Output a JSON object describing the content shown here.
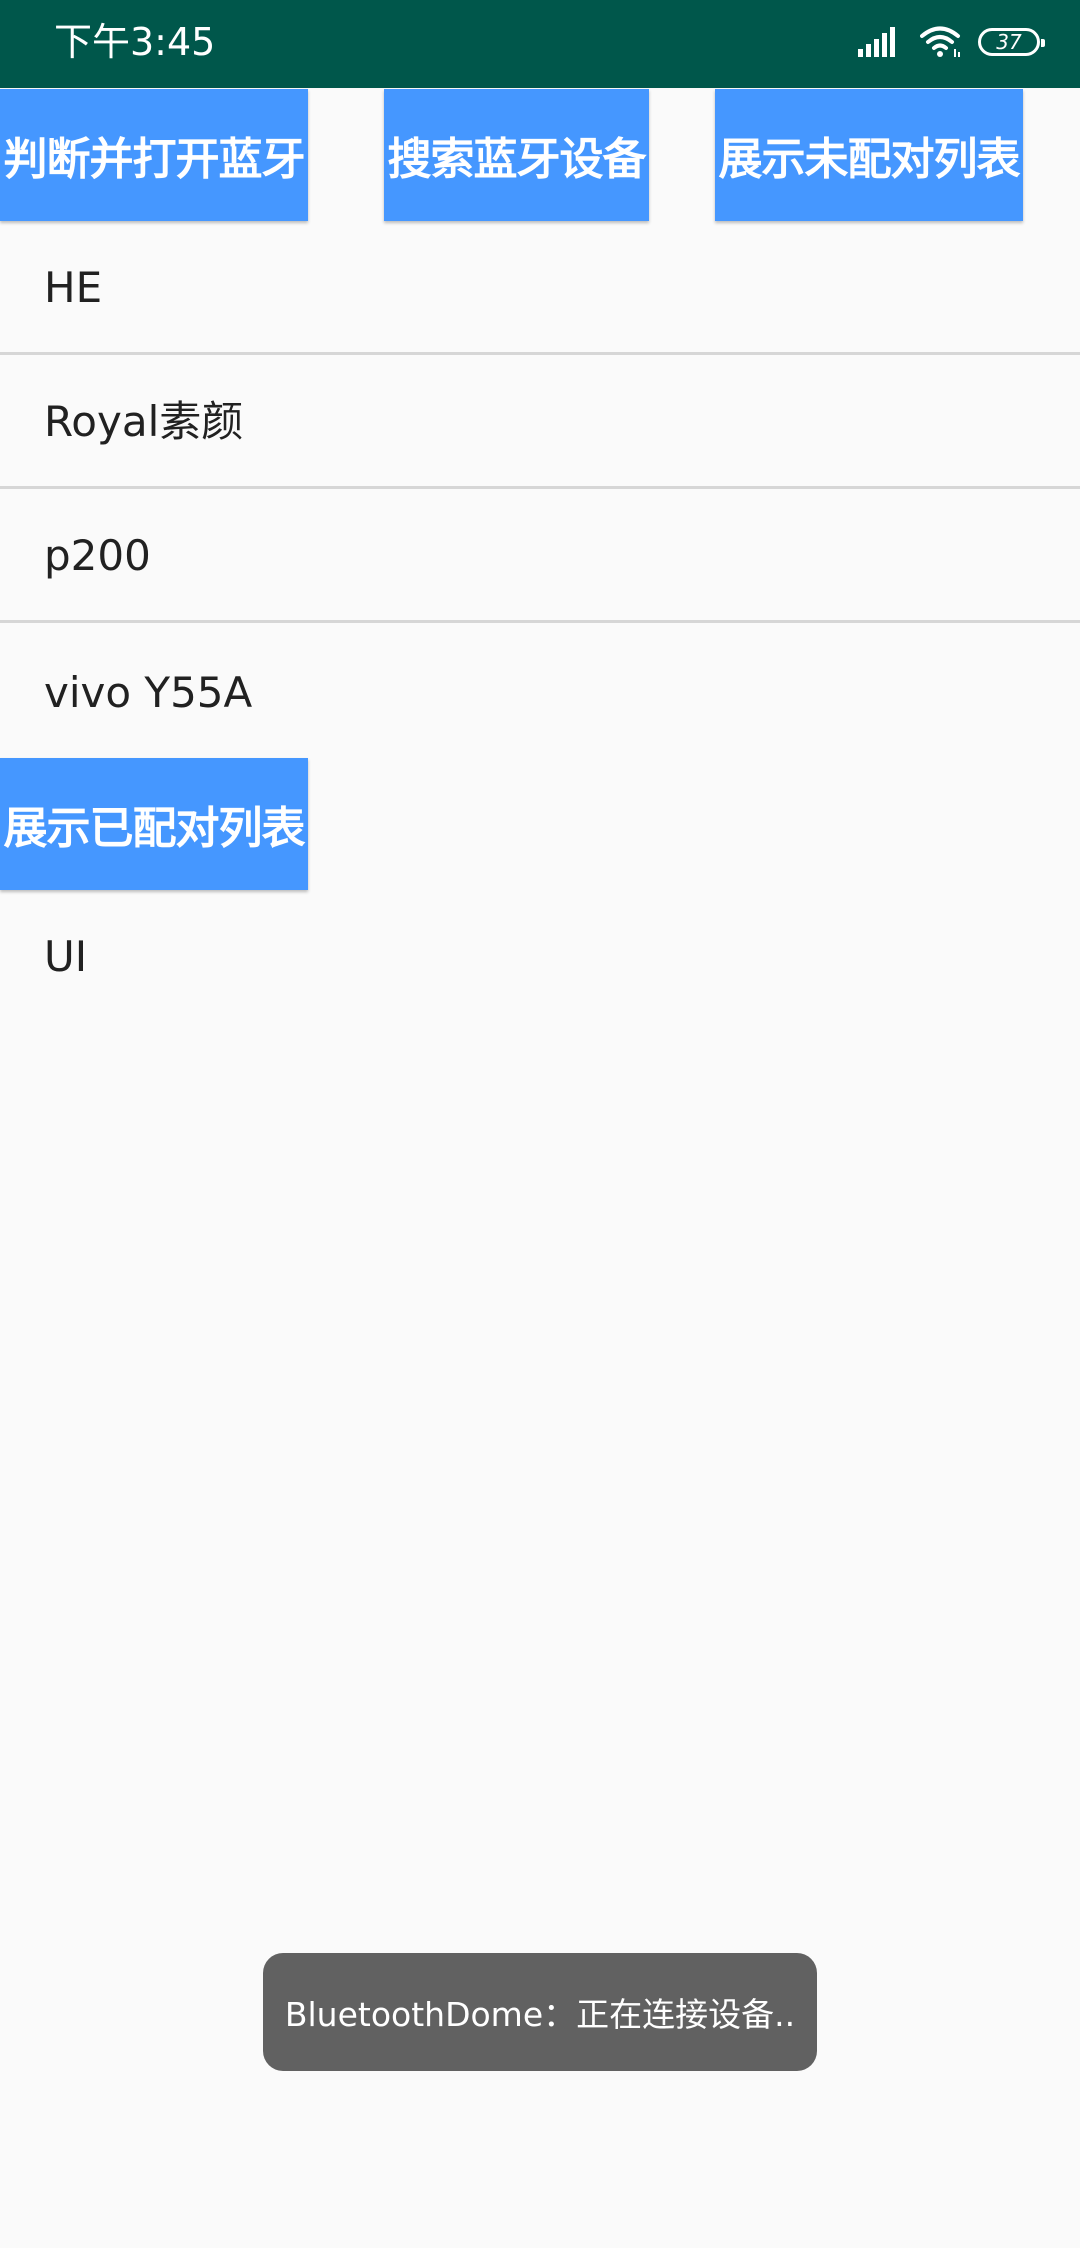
{
  "status_bar": {
    "time": "下午3:45",
    "battery_level": "37",
    "icons": [
      "signal-icon",
      "wifi-icon",
      "battery-icon"
    ],
    "background_color": "#00574b"
  },
  "buttons": {
    "open_bluetooth": "判断并打开蓝牙",
    "search_devices": "搜索蓝牙设备",
    "show_unpaired": "展示未配对列表",
    "show_paired": "展示已配对列表",
    "color": "#4597ff"
  },
  "unpaired_devices": [
    {
      "name": "HE"
    },
    {
      "name": "Royal素颜"
    },
    {
      "name": "p200"
    },
    {
      "name": "vivo Y55A"
    }
  ],
  "paired_devices": [
    {
      "name": "UI"
    }
  ],
  "toast": {
    "message": "BluetoothDome：正在连接设备.."
  }
}
